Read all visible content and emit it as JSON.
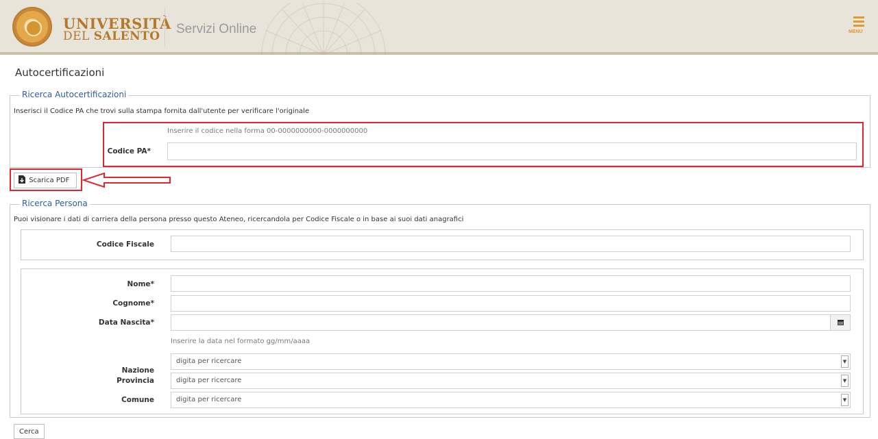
{
  "header": {
    "logo_line1": "UNIVERSITÀ",
    "logo_line2_prefix": "DEL ",
    "logo_line2_bold": "SALENTO",
    "site_title": "Servizi Online",
    "menu_label": "MENU"
  },
  "page": {
    "title": "Autocertificazioni"
  },
  "ricerca_autocertificazioni": {
    "legend": "Ricerca Autocertificazioni",
    "hint": "Inserisci il Codice PA che trovi sulla stampa fornita dall'utente per verificare l'originale",
    "format_hint": "Inserire il codice nella forma 00-0000000000-0000000000",
    "codice_pa_label": "Codice PA*",
    "codice_pa_value": ""
  },
  "scarica_pdf": {
    "label": "Scarica PDF"
  },
  "ricerca_persona": {
    "legend": "Ricerca Persona",
    "hint": "Puoi visionare i dati di carriera della persona presso questo Ateneo, ricercandola per Codice Fiscale o in base ai suoi dati anagrafici",
    "codice_fiscale_label": "Codice Fiscale",
    "nome_label": "Nome*",
    "cognome_label": "Cognome*",
    "data_nascita_label": "Data Nascita*",
    "data_hint": "Inserire la data nel formato gg/mm/aaaa",
    "nazione_label": "Nazione",
    "provincia_label": "Provincia",
    "comune_label": "Comune",
    "nazione_value": "digita per ricercare",
    "provincia_value": "digita per ricercare",
    "comune_value": "digita per ricercare"
  },
  "actions": {
    "cerca_label": "Cerca"
  },
  "colors": {
    "accent_orange": "#e09a32",
    "legend_blue": "#2d5ca2",
    "highlight_red": "#e0262d",
    "header_bg": "#e8e4da"
  }
}
